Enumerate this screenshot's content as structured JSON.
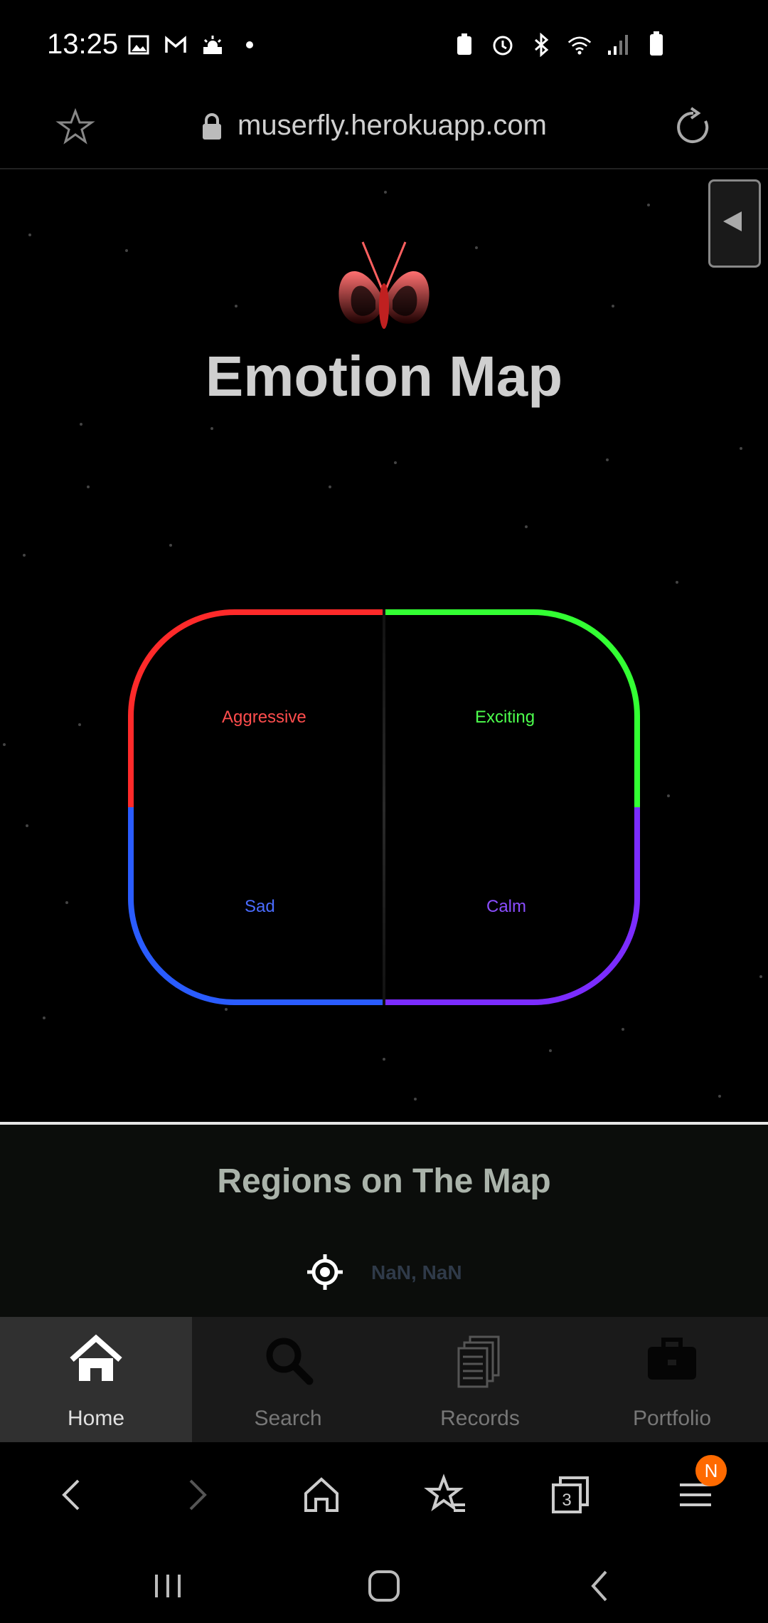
{
  "status_bar": {
    "time": "13:25"
  },
  "browser": {
    "url": "muserfly.herokuapp.com"
  },
  "page": {
    "title": "Emotion Map",
    "quadrants": [
      {
        "label": "Aggressive",
        "color": "#ff2a2a"
      },
      {
        "label": "Exciting",
        "color": "#33ff33"
      },
      {
        "label": "Sad",
        "color": "#2a5cff"
      },
      {
        "label": "Calm",
        "color": "#7b2cff"
      }
    ],
    "regions": {
      "title": "Regions on The Map",
      "coordinates": "NaN, NaN"
    }
  },
  "web_nav": {
    "items": [
      {
        "label": "Home",
        "icon": "home-icon",
        "active": true
      },
      {
        "label": "Search",
        "icon": "search-icon",
        "active": false
      },
      {
        "label": "Records",
        "icon": "records-icon",
        "active": false
      },
      {
        "label": "Portfolio",
        "icon": "briefcase-icon",
        "active": false
      }
    ]
  },
  "browser_toolbar": {
    "tabs_count": "3",
    "menu_badge": "N"
  }
}
